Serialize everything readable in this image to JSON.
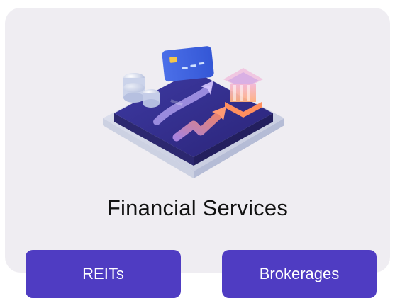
{
  "card": {
    "title": "Financial Services",
    "illustration_icon": "finance-platform-icon"
  },
  "tags": [
    {
      "label": "REITs"
    },
    {
      "label": "Brokerages"
    }
  ],
  "colors": {
    "card_background": "#efedf2",
    "pill_background": "#4f3cc2",
    "pill_text": "#ffffff",
    "title_text": "#111111"
  }
}
